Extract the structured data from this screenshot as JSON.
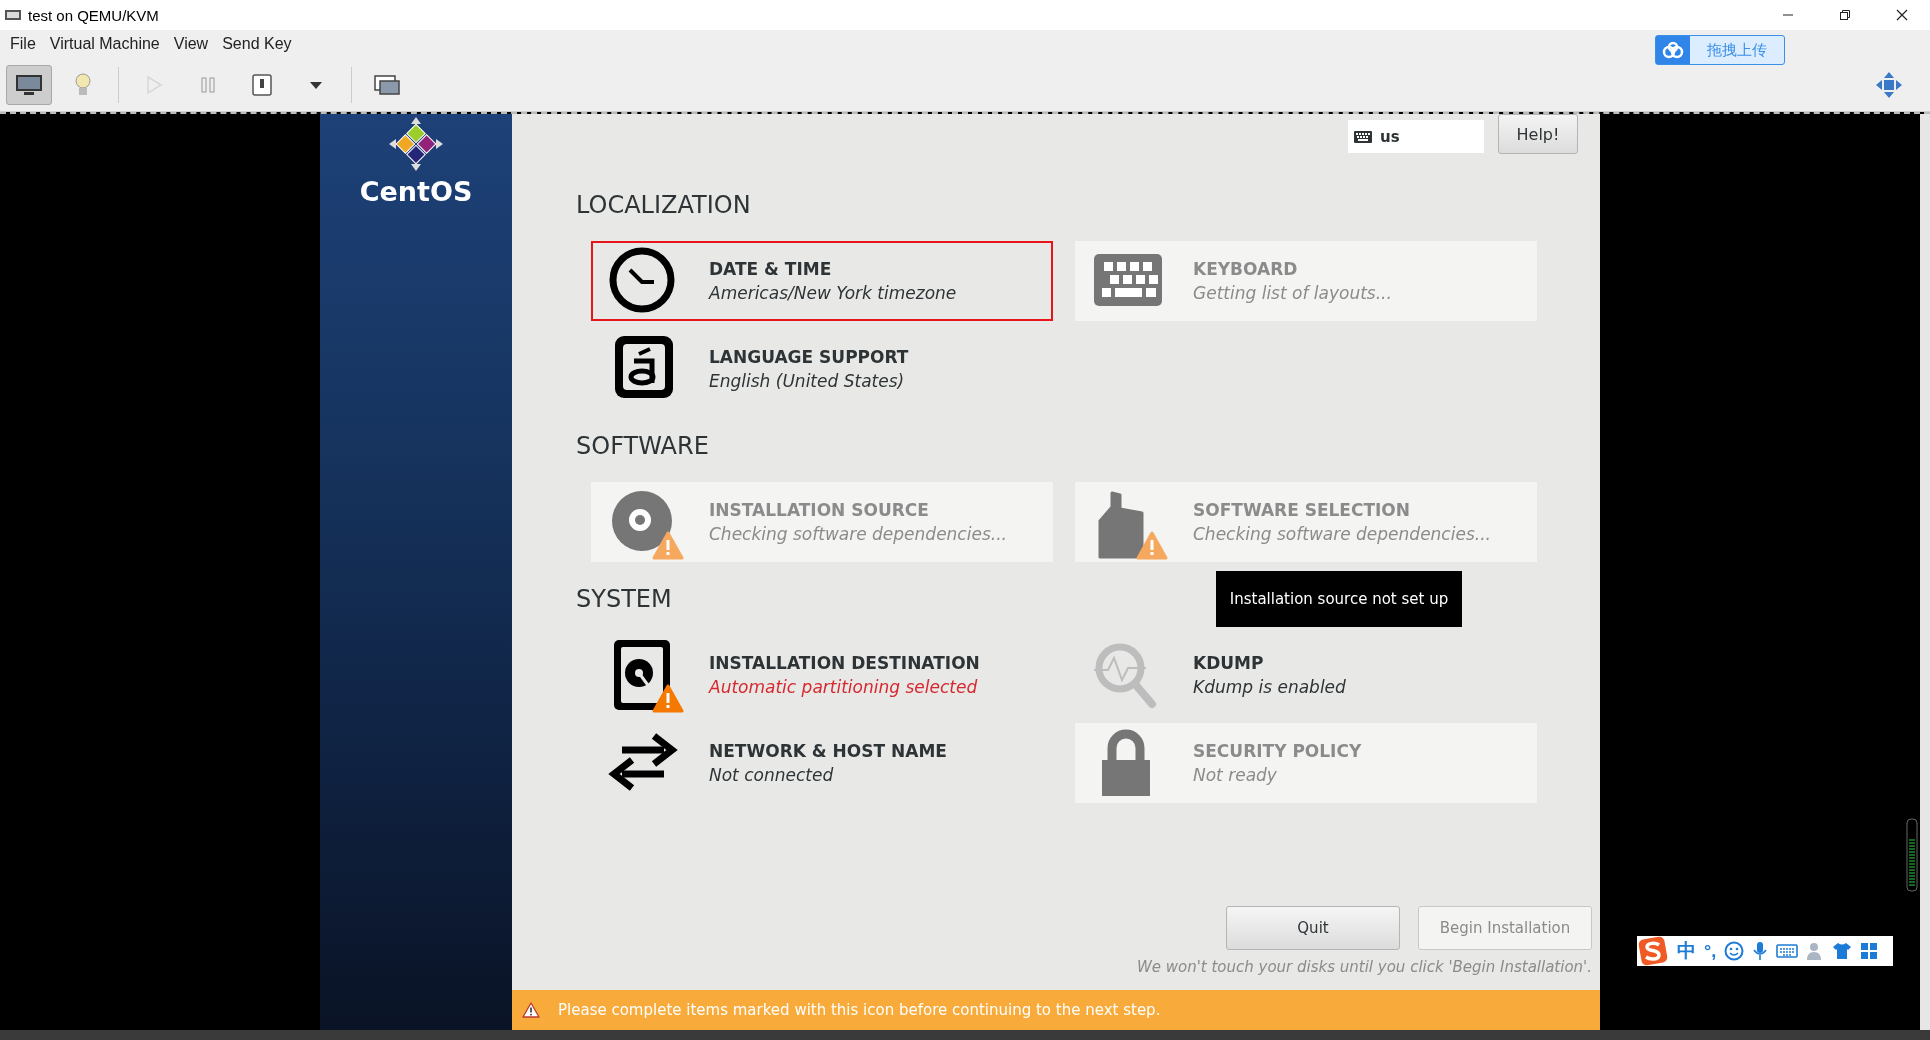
{
  "window": {
    "title": "test on QEMU/KVM"
  },
  "menu": [
    "File",
    "Virtual Machine",
    "View",
    "Send Key"
  ],
  "toolbar": [
    [
      {
        "kind": "console",
        "selected": true,
        "disabled": false
      },
      {
        "kind": "details",
        "selected": false,
        "disabled": false
      }
    ],
    [
      {
        "kind": "run",
        "selected": false,
        "disabled": true
      },
      {
        "kind": "pause",
        "selected": false,
        "disabled": false
      },
      {
        "kind": "shutdown",
        "selected": false,
        "disabled": false
      },
      {
        "kind": "dropdown",
        "selected": false,
        "disabled": false
      }
    ],
    [
      {
        "kind": "screens",
        "selected": false,
        "disabled": false
      }
    ]
  ],
  "upload_button": {
    "label": "拖拽上传"
  },
  "installer": {
    "brand": "CentOS",
    "keyboard_layout": "us",
    "help_button": "Help!",
    "sections": [
      {
        "title": "LOCALIZATION",
        "rows": [
          [
            {
              "kind": "clock",
              "title": "DATE & TIME",
              "status": "Americas/New York timezone",
              "disabled": false,
              "warning": false,
              "status_error": false,
              "outlined": true
            },
            {
              "kind": "keyboard",
              "title": "KEYBOARD",
              "status": "Getting list of layouts...",
              "disabled": true,
              "warning": false,
              "status_error": false,
              "outlined": false
            }
          ],
          [
            {
              "kind": "language",
              "title": "LANGUAGE SUPPORT",
              "status": "English (United States)",
              "disabled": false,
              "warning": false,
              "status_error": false,
              "outlined": false
            }
          ]
        ]
      },
      {
        "title": "SOFTWARE",
        "rows": [
          [
            {
              "kind": "disc",
              "title": "INSTALLATION SOURCE",
              "status": "Checking software dependencies...",
              "disabled": true,
              "warning": true,
              "status_error": false,
              "outlined": false
            },
            {
              "kind": "package",
              "title": "SOFTWARE SELECTION",
              "status": "Checking software dependencies...",
              "disabled": true,
              "warning": true,
              "status_error": false,
              "outlined": false
            }
          ]
        ]
      },
      {
        "title": "SYSTEM",
        "rows": [
          [
            {
              "kind": "disk",
              "title": "INSTALLATION DESTINATION",
              "status": "Automatic partitioning selected",
              "disabled": false,
              "warning": true,
              "status_error": true,
              "outlined": false
            },
            {
              "kind": "kdump",
              "title": "KDUMP",
              "status": "Kdump is enabled",
              "disabled": false,
              "warning": false,
              "status_error": false,
              "outlined": false
            }
          ],
          [
            {
              "kind": "network",
              "title": "NETWORK & HOST NAME",
              "status": "Not connected",
              "disabled": false,
              "warning": false,
              "status_error": false,
              "outlined": false
            },
            {
              "kind": "lock",
              "title": "SECURITY POLICY",
              "status": "Not ready",
              "disabled": true,
              "warning": false,
              "status_error": false,
              "outlined": false
            }
          ]
        ]
      }
    ],
    "tooltip": "Installation source not set up",
    "buttons": [
      {
        "label": "Quit",
        "disabled": false
      },
      {
        "label": "Begin Installation",
        "disabled": true
      }
    ],
    "note": "We won't touch your disks until you click 'Begin Installation'.",
    "warning_bar": "Please complete items marked with this icon before continuing to the next step."
  },
  "ime_bar": {
    "mode": "中",
    "punctuation": "°,"
  }
}
